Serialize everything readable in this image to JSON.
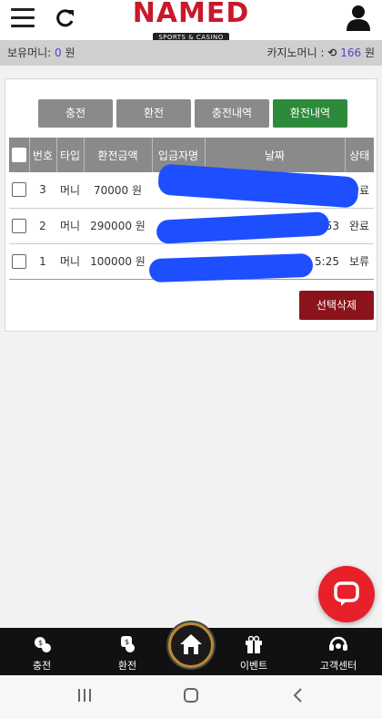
{
  "header": {
    "logo_main": "NAMED",
    "logo_sub": "SPORTS & CASINO",
    "icons": {
      "menu": "hamburger-menu-icon",
      "refresh": "refresh-icon",
      "user": "user-icon"
    }
  },
  "balance": {
    "holding_label": "보유머니:",
    "holding_value": "0",
    "holding_unit": "원",
    "casino_label": "카지노머니 :",
    "casino_value": "166",
    "casino_unit": "원"
  },
  "tabs": [
    {
      "label": "충전"
    },
    {
      "label": "환전"
    },
    {
      "label": "충전내역"
    },
    {
      "label": "환전내역"
    }
  ],
  "table": {
    "headers": [
      "번호",
      "타입",
      "환전금액",
      "입금자명",
      "날짜",
      "상태"
    ],
    "rows": [
      {
        "no": "3",
        "type": "머니",
        "amount": "70000 원",
        "status": "완료"
      },
      {
        "no": "2",
        "type": "머니",
        "amount": "290000 원",
        "date_tail": ":53",
        "status": "완료"
      },
      {
        "no": "1",
        "type": "머니",
        "amount": "100000 원",
        "date_tail": "5:25",
        "status": "보류"
      }
    ]
  },
  "delete_button": "선택삭제",
  "bottom_nav": [
    {
      "label": "충전",
      "icon": "charge-icon"
    },
    {
      "label": "환전",
      "icon": "exchange-icon"
    },
    {
      "label": "",
      "icon": "home-icon"
    },
    {
      "label": "이벤트",
      "icon": "gift-icon"
    },
    {
      "label": "고객센터",
      "icon": "support-headset-icon"
    }
  ],
  "colors": {
    "accent_active_tab": "#2e8a3b",
    "delete": "#8b141c",
    "chat_fab": "#e8202a",
    "logo": "#c8192a"
  }
}
